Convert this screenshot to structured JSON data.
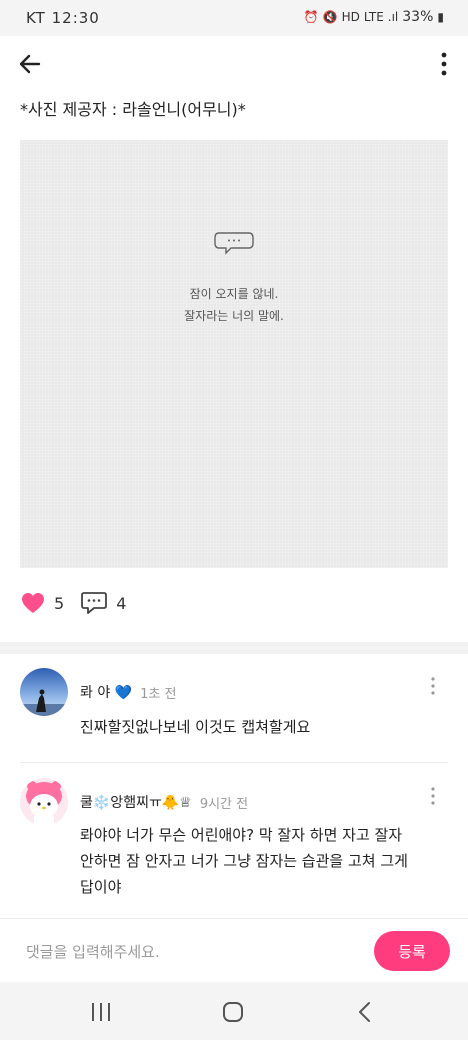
{
  "status_bar": {
    "carrier_time": "KT  12:30",
    "battery": "33%",
    "signal_text": "LTE"
  },
  "post": {
    "text": "*사진 제공자 : 라솔언니(어무니)*",
    "image_lines": [
      "잠이 오지를 않네.",
      "잘자라는 너의 말에."
    ],
    "likes": "5",
    "comments": "4"
  },
  "comments": [
    {
      "name": "롸 야 💙",
      "time": "1초 전",
      "text": "진짜할짓없나보네 이것도 캡쳐할게요"
    },
    {
      "name": "쿨❄️앙햄찌ㅠ🐥♕",
      "time": "9시간 전",
      "text": "롸야야 너가 무슨 어린애야? 막 잘자 하면 자고 잘자 안하면 잠 안자고 너가 그냥 잠자는 습관을 고쳐 그게 답이야"
    }
  ],
  "input": {
    "placeholder": "댓글을 입력해주세요.",
    "submit_label": "등록"
  },
  "colors": {
    "accent": "#ff3c7d",
    "heart": "#ff4f8b",
    "photo_bg": "#e9e9e9"
  },
  "icons": [
    "back-arrow-icon",
    "more-vertical-icon",
    "heart-icon",
    "comment-bubble-icon",
    "recent-apps-icon",
    "home-icon",
    "nav-back-icon"
  ]
}
